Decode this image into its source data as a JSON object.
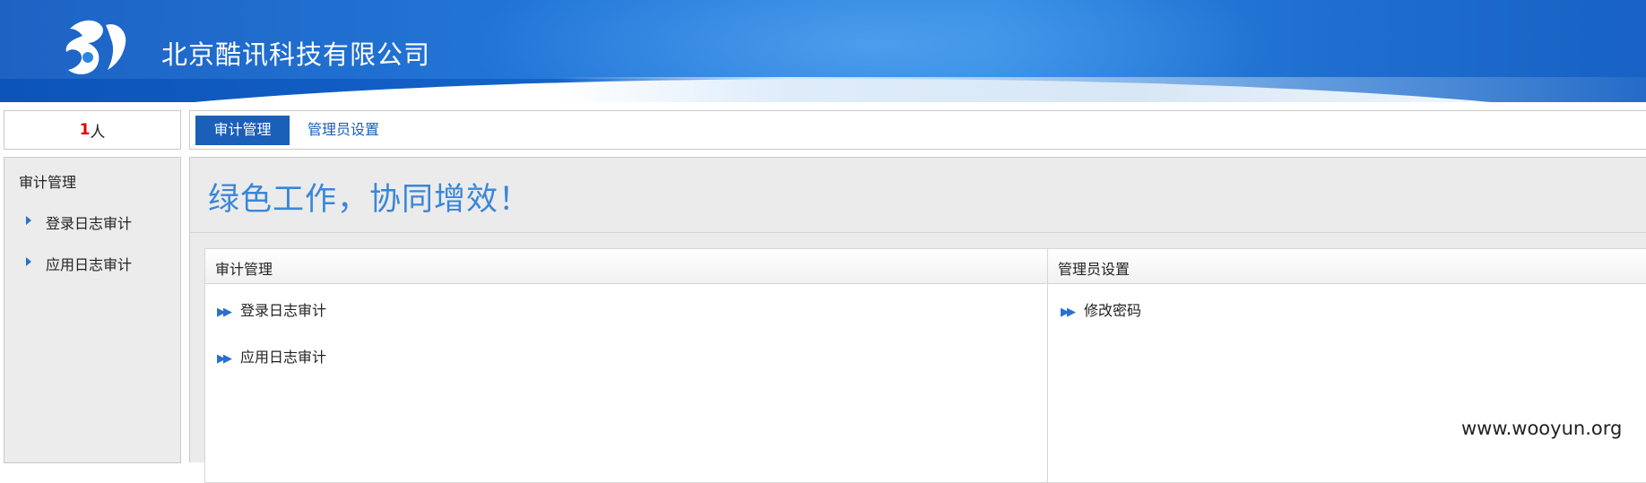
{
  "header": {
    "company_name": "北京酷讯科技有限公司",
    "logo_icon": "company-logo-icon",
    "colors": {
      "banner": "#1f6fd0",
      "accent": "#1a5fb8"
    }
  },
  "user_count": {
    "number": "1",
    "unit": "人",
    "number_color": "#e00000"
  },
  "tabs": [
    {
      "label": "审计管理",
      "active": true
    },
    {
      "label": "管理员设置",
      "active": false
    }
  ],
  "sidebar": {
    "title": "审计管理",
    "items": [
      {
        "label": "登录日志审计",
        "icon": "triangle-right-icon"
      },
      {
        "label": "应用日志审计",
        "icon": "triangle-right-icon"
      }
    ]
  },
  "main": {
    "slogan": "绿色工作，协同增效！",
    "columns": [
      {
        "header": "审计管理",
        "links": [
          {
            "label": "登录日志审计",
            "icon": "double-chevron-right-icon"
          },
          {
            "label": "应用日志审计",
            "icon": "double-chevron-right-icon"
          }
        ]
      },
      {
        "header": "管理员设置",
        "links": [
          {
            "label": "修改密码",
            "icon": "double-chevron-right-icon"
          }
        ]
      }
    ]
  },
  "watermark": "www.wooyun.org"
}
